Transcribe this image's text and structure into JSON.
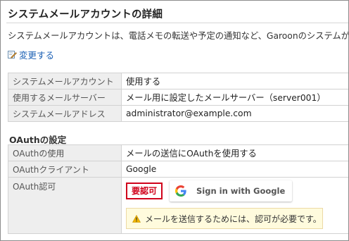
{
  "page": {
    "title": "システムメールアカウントの詳細",
    "description": "システムメールアカウントは、電話メモの転送や予定の通知など、Garoonのシステムが",
    "edit_link": "変更する"
  },
  "account_table": [
    {
      "label": "システムメールアカウント",
      "value": "使用する"
    },
    {
      "label": "使用するメールサーバー",
      "value": "メール用に設定したメールサーバー（server001）"
    },
    {
      "label": "システムメールアドレス",
      "value": "administrator@example.com"
    }
  ],
  "oauth": {
    "section_title": "OAuthの設定",
    "rows": [
      {
        "label": "OAuthの使用",
        "value": "メールの送信にOAuthを使用する"
      },
      {
        "label": "OAuthクライアント",
        "value": "Google"
      }
    ],
    "auth_label": "OAuth認可",
    "auth_status": "要認可",
    "google_button": "Sign in with Google",
    "warning": "メールを送信するためには、認可が必要です。"
  },
  "colors": {
    "link": "#1a5fb4",
    "status_red": "#d0021b",
    "warning_bg": "#fffbdd",
    "label_bg": "#eeeeee"
  },
  "icons": [
    "edit-icon",
    "google-g-icon",
    "warning-icon"
  ]
}
